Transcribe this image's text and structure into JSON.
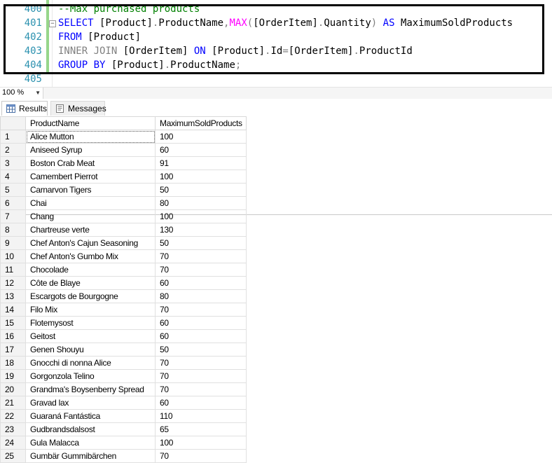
{
  "editor": {
    "lines": [
      {
        "number": "400",
        "tokens": [
          {
            "t": "--Max purchased products",
            "c": "cm"
          }
        ]
      },
      {
        "number": "401",
        "tokens": [
          {
            "t": "SELECT ",
            "c": "kw"
          },
          {
            "t": "[Product]",
            "c": ""
          },
          {
            "t": ".",
            "c": "gy"
          },
          {
            "t": "ProductName",
            "c": ""
          },
          {
            "t": ",",
            "c": "gy"
          },
          {
            "t": "MAX",
            "c": "fn"
          },
          {
            "t": "(",
            "c": "gy"
          },
          {
            "t": "[OrderItem]",
            "c": ""
          },
          {
            "t": ".",
            "c": "gy"
          },
          {
            "t": "Quantity",
            "c": ""
          },
          {
            "t": ") ",
            "c": "gy"
          },
          {
            "t": "AS ",
            "c": "kw"
          },
          {
            "t": "MaximumSoldProducts",
            "c": ""
          }
        ]
      },
      {
        "number": "402",
        "tokens": [
          {
            "t": "FROM ",
            "c": "kw"
          },
          {
            "t": "[Product]",
            "c": ""
          }
        ]
      },
      {
        "number": "403",
        "tokens": [
          {
            "t": "INNER JOIN ",
            "c": "gy"
          },
          {
            "t": "[OrderItem] ",
            "c": ""
          },
          {
            "t": "ON ",
            "c": "kw"
          },
          {
            "t": "[Product]",
            "c": ""
          },
          {
            "t": ".",
            "c": "gy"
          },
          {
            "t": "Id",
            "c": ""
          },
          {
            "t": "=",
            "c": "gy"
          },
          {
            "t": "[OrderItem]",
            "c": ""
          },
          {
            "t": ".",
            "c": "gy"
          },
          {
            "t": "ProductId",
            "c": ""
          }
        ]
      },
      {
        "number": "404",
        "tokens": [
          {
            "t": "GROUP BY ",
            "c": "kw"
          },
          {
            "t": "[Product]",
            "c": ""
          },
          {
            "t": ".",
            "c": "gy"
          },
          {
            "t": "ProductName",
            "c": ""
          },
          {
            "t": ";",
            "c": "gy"
          }
        ]
      },
      {
        "number": "405",
        "tokens": []
      }
    ]
  },
  "zoom": {
    "value": "100 %"
  },
  "tabs": {
    "results_label": "Results",
    "messages_label": "Messages"
  },
  "grid": {
    "columns": [
      "ProductName",
      "MaximumSoldProducts"
    ],
    "rows": [
      [
        "1",
        "Alice Mutton",
        "100"
      ],
      [
        "2",
        "Aniseed Syrup",
        "60"
      ],
      [
        "3",
        "Boston Crab Meat",
        "91"
      ],
      [
        "4",
        "Camembert Pierrot",
        "100"
      ],
      [
        "5",
        "Carnarvon Tigers",
        "50"
      ],
      [
        "6",
        "Chai",
        "80"
      ],
      [
        "7",
        "Chang",
        "100"
      ],
      [
        "8",
        "Chartreuse verte",
        "130"
      ],
      [
        "9",
        "Chef Anton's Cajun Seasoning",
        "50"
      ],
      [
        "10",
        "Chef Anton's Gumbo Mix",
        "70"
      ],
      [
        "11",
        "Chocolade",
        "70"
      ],
      [
        "12",
        "Côte de Blaye",
        "60"
      ],
      [
        "13",
        "Escargots de Bourgogne",
        "80"
      ],
      [
        "14",
        "Filo Mix",
        "70"
      ],
      [
        "15",
        "Flotemysost",
        "60"
      ],
      [
        "16",
        "Geitost",
        "60"
      ],
      [
        "17",
        "Genen Shouyu",
        "50"
      ],
      [
        "18",
        "Gnocchi di nonna Alice",
        "70"
      ],
      [
        "19",
        "Gorgonzola Telino",
        "70"
      ],
      [
        "20",
        "Grandma's Boysenberry Spread",
        "70"
      ],
      [
        "21",
        "Gravad lax",
        "60"
      ],
      [
        "22",
        "Guaraná Fantástica",
        "110"
      ],
      [
        "23",
        "Gudbrandsdalsost",
        "65"
      ],
      [
        "24",
        "Gula Malacca",
        "100"
      ],
      [
        "25",
        "Gumbär Gummibärchen",
        "70"
      ]
    ]
  },
  "colors": {
    "keyword": "#0000ff",
    "function": "#ff00ff",
    "comment": "#008000",
    "operator": "#808080",
    "line_number": "#2b91af",
    "change_bar": "#97d68b"
  }
}
